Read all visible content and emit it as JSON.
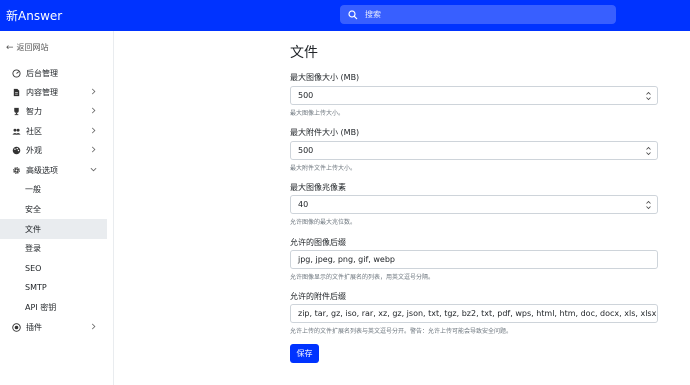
{
  "header": {
    "brand": "新Answer",
    "search_placeholder": "搜索"
  },
  "sidebar": {
    "back_label": "返回网站",
    "items": [
      {
        "label": "后台管理",
        "icon": "dashboard-icon"
      },
      {
        "label": "内容管理",
        "icon": "document-icon"
      },
      {
        "label": "智力",
        "icon": "trophy-icon"
      },
      {
        "label": "社区",
        "icon": "people-icon"
      },
      {
        "label": "外观",
        "icon": "palette-icon"
      },
      {
        "label": "高级选项",
        "icon": "gear-icon"
      },
      {
        "label": "插件",
        "icon": "plugin-icon"
      }
    ],
    "subitems": [
      {
        "label": "一般"
      },
      {
        "label": "安全"
      },
      {
        "label": "文件"
      },
      {
        "label": "登录"
      },
      {
        "label": "SEO"
      },
      {
        "label": "SMTP"
      },
      {
        "label": "API 密钥"
      }
    ],
    "active_subitem": "文件"
  },
  "main": {
    "title": "文件",
    "max_image_size": {
      "label": "最大图像大小 (MB)",
      "value": "500",
      "help": "最大图像上传大小。"
    },
    "max_attachment_size": {
      "label": "最大附件大小 (MB)",
      "value": "500",
      "help": "最大附件文件上传大小。"
    },
    "max_image_megapixel": {
      "label": "最大图像兆像素",
      "value": "40",
      "help": "允许图像的最大兆位数。"
    },
    "image_extensions": {
      "label": "允许的图像后缀",
      "value": "jpg, jpeg, png, gif, webp",
      "help": "允许图像显示的文件扩展名的列表，用英文逗号分隔。"
    },
    "attachment_extensions": {
      "label": "允许的附件后缀",
      "value": "zip, tar, gz, iso, rar, xz, gz, json, txt, tgz, bz2, txt, pdf, wps, html, htm, doc, docx, xls, xlsx, et, ppt",
      "help": "允许上传的文件扩展名列表与英文逗号分开。警告：允许上传可能会导致安全问题。"
    },
    "save_label": "保存"
  },
  "colors": {
    "brand": "#0033ff",
    "active_bg": "#e9ecef"
  }
}
